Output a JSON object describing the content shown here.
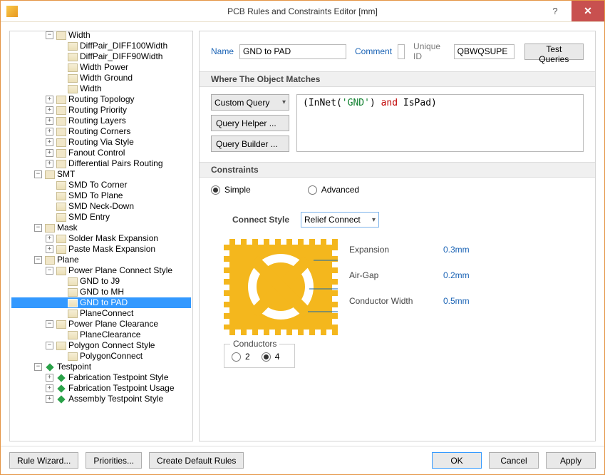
{
  "window": {
    "title": "PCB Rules and Constraints Editor [mm]"
  },
  "tree": {
    "items": [
      {
        "depth": 3,
        "exp": "-",
        "icon": "cat",
        "label": "Width"
      },
      {
        "depth": 4,
        "exp": "",
        "icon": "rule",
        "label": "DiffPair_DIFF100Width"
      },
      {
        "depth": 4,
        "exp": "",
        "icon": "rule",
        "label": "DiffPair_DIFF90Width"
      },
      {
        "depth": 4,
        "exp": "",
        "icon": "rule",
        "label": "Width Power"
      },
      {
        "depth": 4,
        "exp": "",
        "icon": "rule",
        "label": "Width Ground"
      },
      {
        "depth": 4,
        "exp": "",
        "icon": "rule",
        "label": "Width"
      },
      {
        "depth": 3,
        "exp": "+",
        "icon": "cat",
        "label": "Routing Topology"
      },
      {
        "depth": 3,
        "exp": "+",
        "icon": "cat",
        "label": "Routing Priority"
      },
      {
        "depth": 3,
        "exp": "+",
        "icon": "cat",
        "label": "Routing Layers"
      },
      {
        "depth": 3,
        "exp": "+",
        "icon": "cat",
        "label": "Routing Corners"
      },
      {
        "depth": 3,
        "exp": "+",
        "icon": "cat",
        "label": "Routing Via Style"
      },
      {
        "depth": 3,
        "exp": "+",
        "icon": "cat",
        "label": "Fanout Control"
      },
      {
        "depth": 3,
        "exp": "+",
        "icon": "cat",
        "label": "Differential Pairs Routing"
      },
      {
        "depth": 2,
        "exp": "-",
        "icon": "cat",
        "label": "SMT"
      },
      {
        "depth": 3,
        "exp": "",
        "icon": "rule",
        "label": "SMD To Corner"
      },
      {
        "depth": 3,
        "exp": "",
        "icon": "rule",
        "label": "SMD To Plane"
      },
      {
        "depth": 3,
        "exp": "",
        "icon": "rule",
        "label": "SMD Neck-Down"
      },
      {
        "depth": 3,
        "exp": "",
        "icon": "rule",
        "label": "SMD Entry"
      },
      {
        "depth": 2,
        "exp": "-",
        "icon": "cat",
        "label": "Mask"
      },
      {
        "depth": 3,
        "exp": "+",
        "icon": "rule",
        "label": "Solder Mask Expansion"
      },
      {
        "depth": 3,
        "exp": "+",
        "icon": "rule",
        "label": "Paste Mask Expansion"
      },
      {
        "depth": 2,
        "exp": "-",
        "icon": "cat",
        "label": "Plane"
      },
      {
        "depth": 3,
        "exp": "-",
        "icon": "rule",
        "label": "Power Plane Connect Style"
      },
      {
        "depth": 4,
        "exp": "",
        "icon": "rule",
        "label": "GND to J9"
      },
      {
        "depth": 4,
        "exp": "",
        "icon": "rule",
        "label": "GND to MH"
      },
      {
        "depth": 4,
        "exp": "",
        "icon": "rule",
        "label": "GND to PAD",
        "selected": true
      },
      {
        "depth": 4,
        "exp": "",
        "icon": "rule",
        "label": "PlaneConnect"
      },
      {
        "depth": 3,
        "exp": "-",
        "icon": "rule",
        "label": "Power Plane Clearance"
      },
      {
        "depth": 4,
        "exp": "",
        "icon": "rule",
        "label": "PlaneClearance"
      },
      {
        "depth": 3,
        "exp": "-",
        "icon": "rule",
        "label": "Polygon Connect Style"
      },
      {
        "depth": 4,
        "exp": "",
        "icon": "rule",
        "label": "PolygonConnect"
      },
      {
        "depth": 2,
        "exp": "-",
        "icon": "testpt",
        "label": "Testpoint"
      },
      {
        "depth": 3,
        "exp": "+",
        "icon": "testpt",
        "label": "Fabrication Testpoint Style"
      },
      {
        "depth": 3,
        "exp": "+",
        "icon": "testpt",
        "label": "Fabrication Testpoint Usage"
      },
      {
        "depth": 3,
        "exp": "+",
        "icon": "testpt",
        "label": "Assembly Testpoint Style"
      }
    ]
  },
  "form": {
    "name_label": "Name",
    "name_value": "GND to PAD",
    "comment_label": "Comment",
    "comment_value": "",
    "uniqueid_label": "Unique ID",
    "uniqueid_value": "QBWQSUPE",
    "test_queries": "Test Queries"
  },
  "where": {
    "heading": "Where The Object Matches",
    "dropdown": "Custom Query",
    "query_prefix": "(InNet(",
    "query_str": "'GND'",
    "query_mid": ") ",
    "query_and": "and",
    "query_suffix": " IsPad)",
    "helper": "Query Helper ...",
    "builder": "Query Builder ..."
  },
  "constraints": {
    "heading": "Constraints",
    "simple": "Simple",
    "advanced": "Advanced",
    "connect_style_label": "Connect Style",
    "connect_style_value": "Relief Connect",
    "params": {
      "expansion_label": "Expansion",
      "expansion_value": "0.3mm",
      "airgap_label": "Air-Gap",
      "airgap_value": "0.2mm",
      "conductorw_label": "Conductor Width",
      "conductorw_value": "0.5mm"
    },
    "conductors_label": "Conductors",
    "conductors_2": "2",
    "conductors_4": "4"
  },
  "footer": {
    "rule_wizard": "Rule Wizard...",
    "priorities": "Priorities...",
    "create_default": "Create Default Rules",
    "ok": "OK",
    "cancel": "Cancel",
    "apply": "Apply"
  }
}
